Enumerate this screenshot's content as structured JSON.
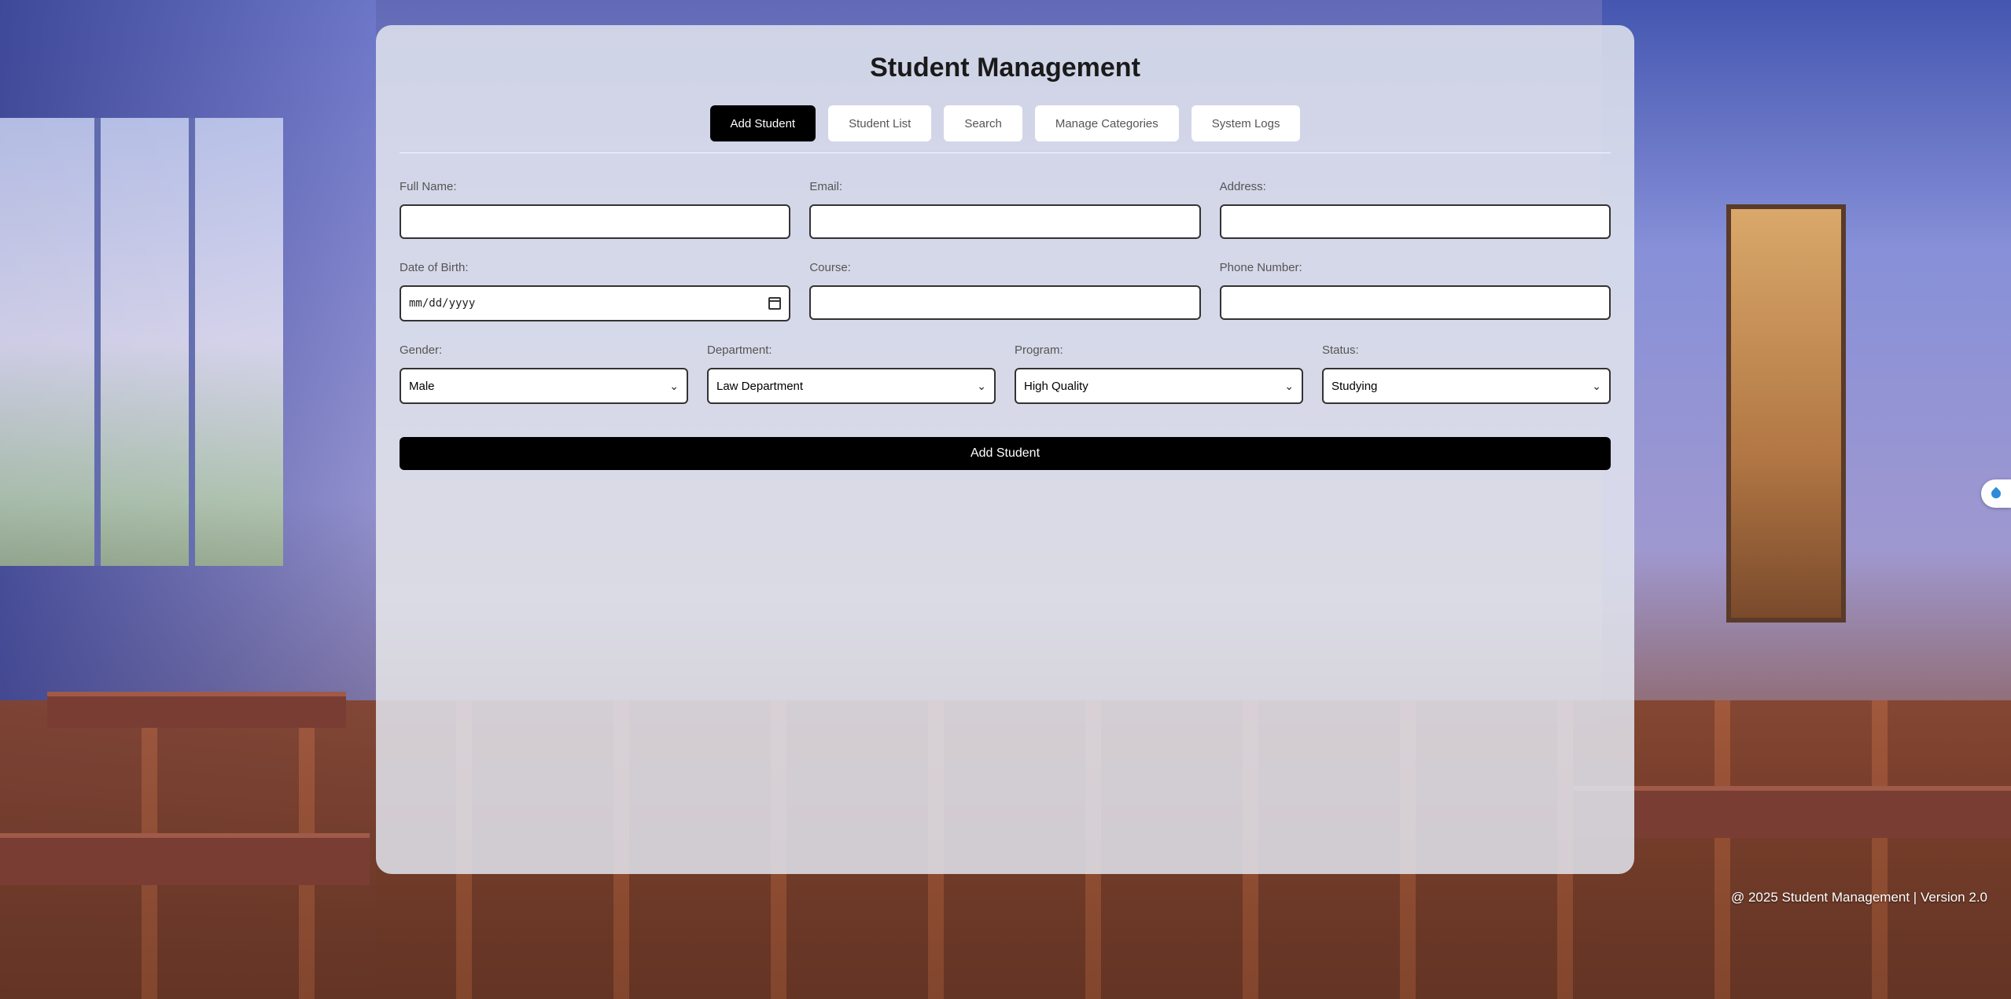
{
  "app": {
    "title": "Student Management"
  },
  "tabs": [
    {
      "label": "Add Student",
      "active": true
    },
    {
      "label": "Student List",
      "active": false
    },
    {
      "label": "Search",
      "active": false
    },
    {
      "label": "Manage Categories",
      "active": false
    },
    {
      "label": "System Logs",
      "active": false
    }
  ],
  "form": {
    "full_name": {
      "label": "Full Name:",
      "value": ""
    },
    "email": {
      "label": "Email:",
      "value": ""
    },
    "address": {
      "label": "Address:",
      "value": ""
    },
    "dob": {
      "label": "Date of Birth:",
      "placeholder": "mm/dd/yyyy"
    },
    "course": {
      "label": "Course:",
      "value": ""
    },
    "phone": {
      "label": "Phone Number:",
      "value": ""
    },
    "gender": {
      "label": "Gender:",
      "selected": "Male"
    },
    "department": {
      "label": "Department:",
      "selected": "Law Department"
    },
    "program": {
      "label": "Program:",
      "selected": "High Quality"
    },
    "status": {
      "label": "Status:",
      "selected": "Studying"
    },
    "submit_label": "Add Student"
  },
  "footer": {
    "text": "@ 2025 Student Management | Version 2.0"
  },
  "icons": {
    "calendar": "calendar-icon",
    "side_widget": "droplet-icon"
  },
  "colors": {
    "active_tab_bg": "#000000",
    "submit_bg": "#000000",
    "panel_bg": "#e1e4ee",
    "side_icon": "#2e8bd8"
  }
}
